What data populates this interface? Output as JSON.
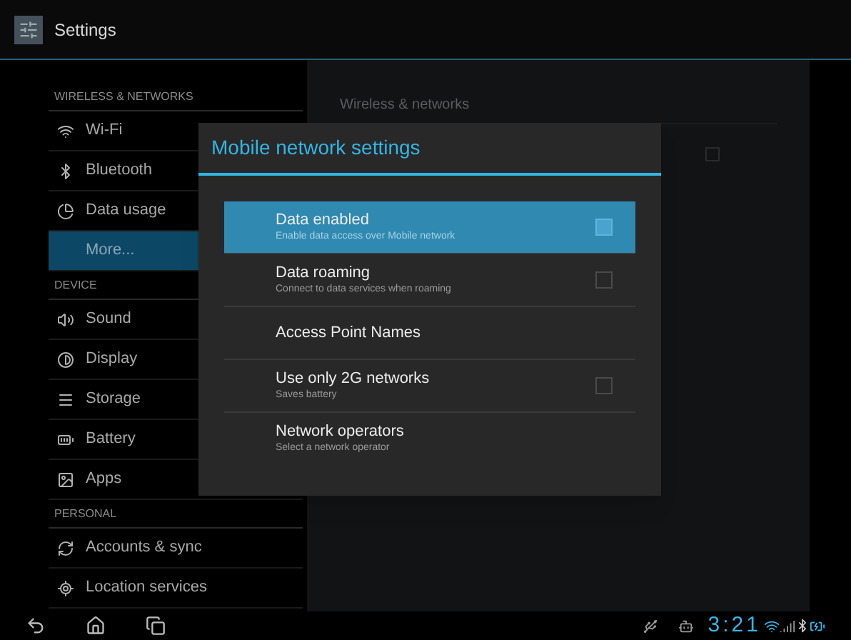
{
  "app_bar": {
    "title": "Settings"
  },
  "sidebar": {
    "sections": [
      {
        "header": "WIRELESS & NETWORKS",
        "items": [
          {
            "label": "Wi-Fi",
            "selected": false
          },
          {
            "label": "Bluetooth",
            "selected": false
          },
          {
            "label": "Data usage",
            "selected": false
          },
          {
            "label": "More...",
            "selected": true
          }
        ]
      },
      {
        "header": "DEVICE",
        "items": [
          {
            "label": "Sound",
            "selected": false
          },
          {
            "label": "Display",
            "selected": false
          },
          {
            "label": "Storage",
            "selected": false
          },
          {
            "label": "Battery",
            "selected": false
          },
          {
            "label": "Apps",
            "selected": false
          }
        ]
      },
      {
        "header": "PERSONAL",
        "items": [
          {
            "label": "Accounts & sync",
            "selected": false
          },
          {
            "label": "Location services",
            "selected": false
          }
        ]
      }
    ]
  },
  "detail_pane": {
    "title": "Wireless & networks",
    "checkbox": {
      "checked": false
    }
  },
  "dialog": {
    "title": "Mobile network settings",
    "items": [
      {
        "kind": "checkbox",
        "title": "Data enabled",
        "summary": "Enable data access over Mobile network",
        "checked": false,
        "selected": true
      },
      {
        "kind": "checkbox",
        "title": "Data roaming",
        "summary": "Connect to data services when roaming",
        "checked": false,
        "selected": false
      },
      {
        "kind": "plain",
        "title": "Access Point Names",
        "selected": false
      },
      {
        "kind": "checkbox",
        "title": "Use only 2G networks",
        "summary": "Saves battery",
        "checked": false,
        "selected": false
      },
      {
        "kind": "plain",
        "title": "Network operators",
        "summary": "Select a network operator",
        "selected": false
      }
    ]
  },
  "status_bar": {
    "time": "3:21"
  }
}
